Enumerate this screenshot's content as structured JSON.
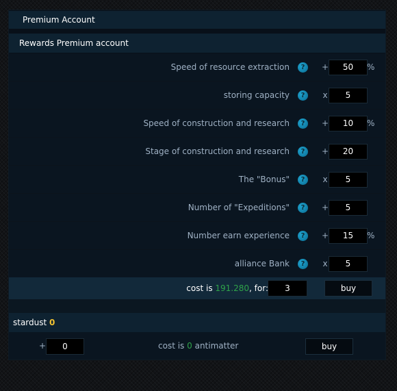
{
  "panel": {
    "title": "Premium Account",
    "subtitle": "Rewards Premium account"
  },
  "rewards": [
    {
      "label": "Speed of resource extraction",
      "op": "+",
      "value": "50",
      "unit": "%",
      "help": "?"
    },
    {
      "label": "storing capacity",
      "op": "x",
      "value": "5",
      "unit": "",
      "help": "?"
    },
    {
      "label": "Speed of construction and research",
      "op": "+",
      "value": "10",
      "unit": "%",
      "help": "?"
    },
    {
      "label": "Stage of construction and research",
      "op": "+",
      "value": "20",
      "unit": "",
      "help": "?"
    },
    {
      "label": "The \"Bonus\"",
      "op": "x",
      "value": "5",
      "unit": "",
      "help": "?"
    },
    {
      "label": "Number of \"Expeditions\"",
      "op": "+",
      "value": "5",
      "unit": "",
      "help": "?"
    },
    {
      "label": "Number earn experience",
      "op": "+",
      "value": "15",
      "unit": "%",
      "help": "?"
    },
    {
      "label": "alliance Bank",
      "op": "x",
      "value": "5",
      "unit": "",
      "help": "?"
    }
  ],
  "purchase": {
    "cost_prefix": "cost is",
    "cost_value": "191.280",
    "cost_suffix": ", for:",
    "days": "3",
    "buy_label": "buy"
  },
  "stardust": {
    "label": "stardust",
    "amount": "0"
  },
  "exchange": {
    "plus": "+",
    "amount": "0",
    "cost_prefix": "cost is",
    "cost_value": "0",
    "cost_suffix": "antimatter",
    "buy_label": "buy"
  },
  "colors": {
    "panel_bg": "#081019",
    "header_bg": "#0e2231",
    "accent_green": "#2fa34a",
    "stardust_gold": "#f1c232",
    "help_icon": "#1fa3cf"
  }
}
